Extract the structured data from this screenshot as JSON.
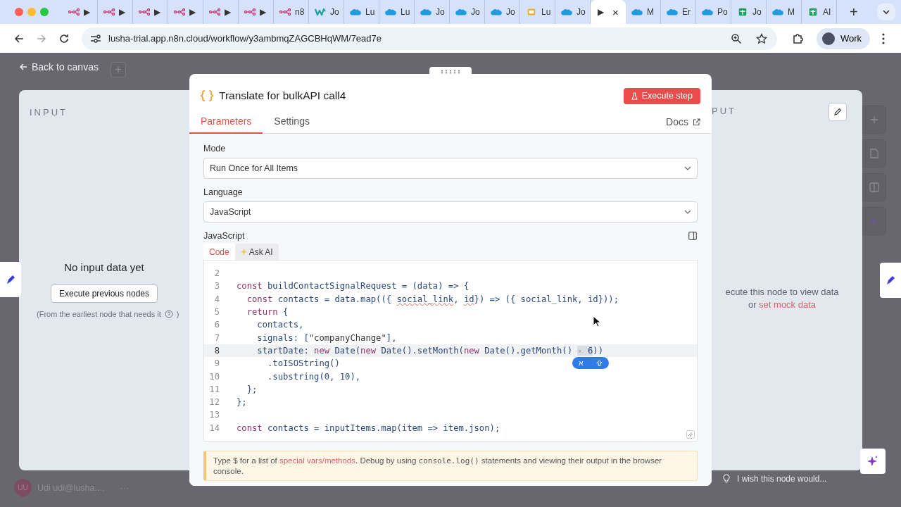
{
  "browser": {
    "tabs": [
      {
        "kind": "workflow",
        "title": "▶",
        "selected": false
      },
      {
        "kind": "workflow",
        "title": "▶",
        "selected": false
      },
      {
        "kind": "workflow",
        "title": "▶",
        "selected": false
      },
      {
        "kind": "workflow",
        "title": "▶",
        "selected": false
      },
      {
        "kind": "workflow",
        "title": "▶",
        "selected": false
      },
      {
        "kind": "workflow",
        "title": "▶",
        "selected": false
      },
      {
        "kind": "workflow",
        "title": "n8",
        "selected": false
      },
      {
        "kind": "wave",
        "title": "Jo",
        "selected": false
      },
      {
        "kind": "cloud",
        "title": "Lu",
        "selected": false
      },
      {
        "kind": "cloud",
        "title": "Lu",
        "selected": false
      },
      {
        "kind": "cloud",
        "title": "Jo",
        "selected": false
      },
      {
        "kind": "cloud",
        "title": "Jo",
        "selected": false
      },
      {
        "kind": "cloud",
        "title": "Jo",
        "selected": false
      },
      {
        "kind": "slides",
        "title": "Lu",
        "selected": false
      },
      {
        "kind": "cloud",
        "title": "Jo",
        "selected": false
      },
      {
        "kind": "plain",
        "title": "▶",
        "close": "×",
        "selected": true
      },
      {
        "kind": "cloud",
        "title": "M",
        "selected": false
      },
      {
        "kind": "cloud",
        "title": "Er",
        "selected": false
      },
      {
        "kind": "cloud",
        "title": "Po",
        "selected": false
      },
      {
        "kind": "sheet",
        "title": "Jo",
        "selected": false
      },
      {
        "kind": "cloud",
        "title": "M",
        "selected": false
      },
      {
        "kind": "sheet",
        "title": "AI",
        "selected": false
      }
    ],
    "new_tab": "+",
    "url": "lusha-trial.app.n8n.cloud/workflow/y3ambmqZAGCBHqWM/7ead7e",
    "profile": "Work",
    "forward_disabled": true
  },
  "canvas": {
    "back_link": "Back to canvas",
    "add": "+",
    "user_initials": "UU",
    "user": "Udi udi@lusha....",
    "more": "···",
    "feedback": "I wish this node would..."
  },
  "input_panel": {
    "heading": "INPUT",
    "message": "No input data yet",
    "button": "Execute previous nodes",
    "note": "(From the earliest node that needs it",
    "note_end": ")"
  },
  "output_panel": {
    "heading": "PUT",
    "message": "ecute this node to view data",
    "or": "or ",
    "link": "set mock data"
  },
  "node": {
    "title": "Translate for bulkAPI call4",
    "execute": "Execute step",
    "tabs": [
      {
        "label": "Parameters",
        "selected": true
      },
      {
        "label": "Settings",
        "selected": false
      }
    ],
    "docs": "Docs",
    "fields": [
      {
        "label": "Mode",
        "value": "Run Once for All Items"
      },
      {
        "label": "Language",
        "value": "JavaScript"
      }
    ],
    "editor_label": "JavaScript",
    "editor_tabs": [
      {
        "label": "Code",
        "selected": true
      },
      {
        "label": "Ask AI",
        "selected": false
      }
    ],
    "code_lines": [
      {
        "number": "2",
        "current": false
      },
      {
        "number": "3",
        "current": false,
        "tokens": [
          {
            "kind": "kw",
            "text": "const "
          },
          {
            "kind": "code",
            "text": "buildContactSignalRequest = (data) => {"
          }
        ]
      },
      {
        "number": "4",
        "current": false,
        "tokens": [
          {
            "kind": "kw",
            "text": "  const "
          },
          {
            "kind": "code",
            "text": "contacts = data.map(({ "
          },
          {
            "kind": "warn",
            "text": "social_link"
          },
          {
            "kind": "code",
            "text": ", "
          },
          {
            "kind": "warn",
            "text": "id"
          },
          {
            "kind": "code",
            "text": "}) => ({ social_link, id}));"
          }
        ]
      },
      {
        "number": "5",
        "current": false,
        "tokens": [
          {
            "kind": "kw",
            "text": "  return "
          },
          {
            "kind": "code",
            "text": "{"
          }
        ]
      },
      {
        "number": "6",
        "current": false,
        "tokens": [
          {
            "kind": "code",
            "text": "    contacts,"
          }
        ]
      },
      {
        "number": "7",
        "current": false,
        "tokens": [
          {
            "kind": "code",
            "text": "    signals: ["
          },
          {
            "kind": "str",
            "text": "\"companyChange\""
          },
          {
            "kind": "code",
            "text": "],"
          }
        ]
      },
      {
        "number": "8",
        "current": true,
        "tokens": [
          {
            "kind": "code",
            "text": "    startDate: "
          },
          {
            "kind": "kw",
            "text": "new "
          },
          {
            "kind": "code",
            "text": "Date("
          },
          {
            "kind": "kw",
            "text": "new "
          },
          {
            "kind": "code",
            "text": "Date().setMonth("
          },
          {
            "kind": "kw",
            "text": "new "
          },
          {
            "kind": "code",
            "text": "Date().getMonth() "
          },
          {
            "kind": "sel",
            "text": "- 6"
          },
          {
            "kind": "code",
            "text": "))"
          }
        ]
      },
      {
        "number": "9",
        "current": false,
        "tokens": [
          {
            "kind": "code",
            "text": "      .toISOString()"
          }
        ]
      },
      {
        "number": "10",
        "current": false,
        "tokens": [
          {
            "kind": "code",
            "text": "      .substring(0, 10),"
          }
        ]
      },
      {
        "number": "11",
        "current": false,
        "tokens": [
          {
            "kind": "code",
            "text": "  };"
          }
        ]
      },
      {
        "number": "12",
        "current": false,
        "tokens": [
          {
            "kind": "code",
            "text": "};"
          }
        ]
      },
      {
        "number": "13",
        "current": false
      },
      {
        "number": "14",
        "current": false,
        "tokens": [
          {
            "kind": "kw",
            "text": "const "
          },
          {
            "kind": "code",
            "text": "contacts = inputItems.map(item => item.json);"
          }
        ]
      }
    ],
    "hint": {
      "before": "Type $ for a list of ",
      "link": "special vars/methods",
      "middle": ". Debug by using ",
      "code": "console.log()",
      "after": " statements and viewing their output in the browser console."
    }
  },
  "ime_badge": "א"
}
